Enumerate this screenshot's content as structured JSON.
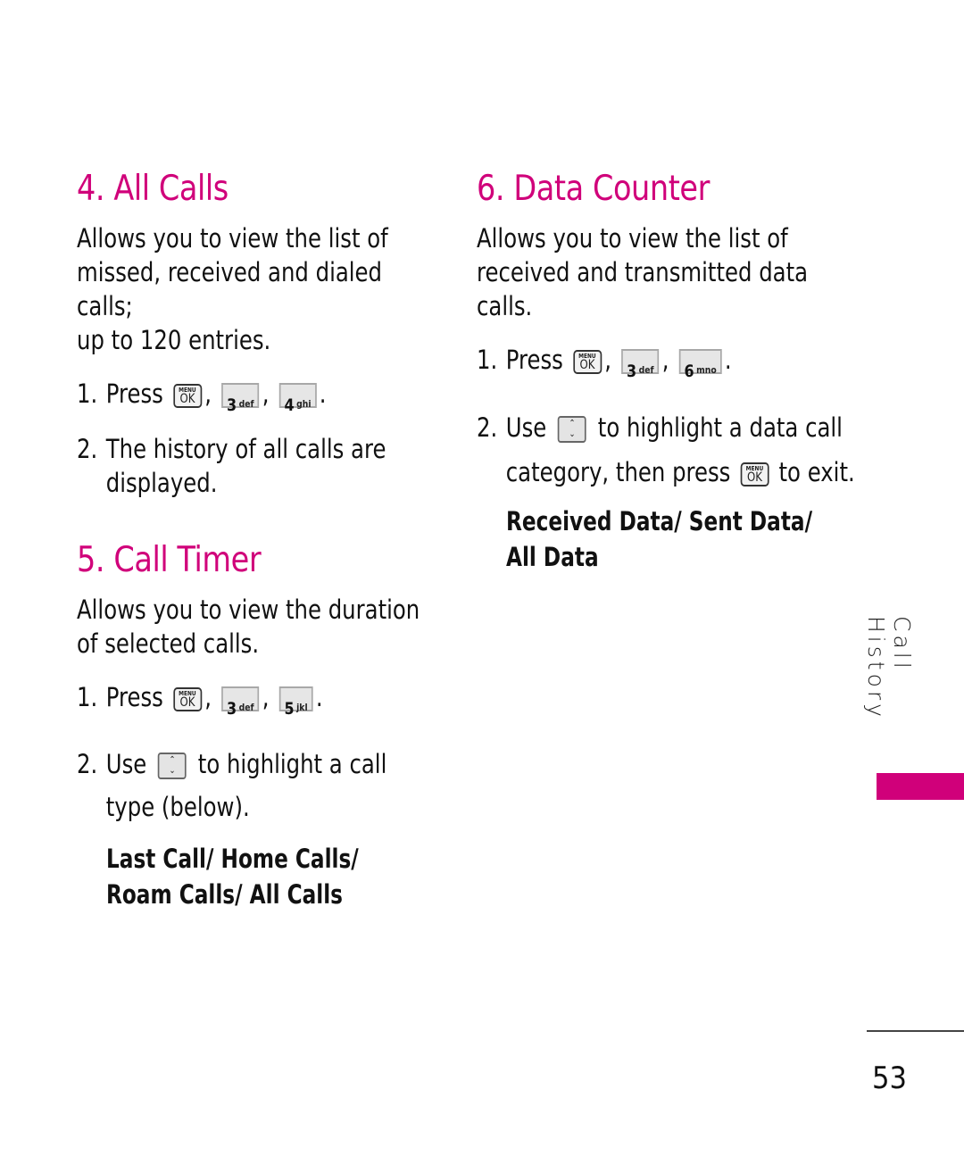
{
  "colors": {
    "accent": "#d0007a",
    "text": "#111111"
  },
  "keys": {
    "menu_ok": {
      "top": "MENU",
      "bottom": "OK"
    },
    "key3": {
      "digit": "3",
      "letters": "def"
    },
    "key4": {
      "digit": "4",
      "letters": "ghi"
    },
    "key5": {
      "digit": "5",
      "letters": "jkl"
    },
    "key6": {
      "digit": "6",
      "letters": "mno"
    },
    "nav": {
      "up": "⌃",
      "down": "⌄"
    }
  },
  "sections": {
    "all_calls": {
      "title": "4. All Calls",
      "description": [
        "Allows you to view the list of",
        "missed, received and dialed calls;",
        "up to 120 entries."
      ],
      "step1": {
        "num": "1.",
        "text": "Press",
        "sep1": ",",
        "sep2": ",",
        "end": "."
      },
      "step2": {
        "num": "2.",
        "lines": [
          "The history of all calls are",
          "displayed."
        ]
      }
    },
    "call_timer": {
      "title": "5. Call Timer",
      "description": [
        "Allows you to view the duration",
        "of selected calls."
      ],
      "step1": {
        "num": "1.",
        "text": "Press",
        "sep1": ",",
        "sep2": ",",
        "end": "."
      },
      "step2": {
        "num": "2.",
        "use": "Use",
        "after": "to highlight a call",
        "line2": "type (below)."
      },
      "options": [
        "Last Call/ Home Calls/",
        "Roam Calls/ All Calls"
      ]
    },
    "data_counter": {
      "title": "6. Data Counter",
      "description": [
        "Allows you to view the list of",
        "received and transmitted data",
        "calls."
      ],
      "step1": {
        "num": "1.",
        "text": "Press",
        "sep1": ",",
        "sep2": ",",
        "end": "."
      },
      "step2": {
        "num": "2.",
        "use": "Use",
        "after": "to highlight a data call",
        "line2_before": "category, then press",
        "line2_after": "to exit."
      },
      "options": [
        "Received Data/ Sent Data/",
        "All Data"
      ]
    }
  },
  "side_tab": {
    "label": "Call History"
  },
  "page_number": "53"
}
